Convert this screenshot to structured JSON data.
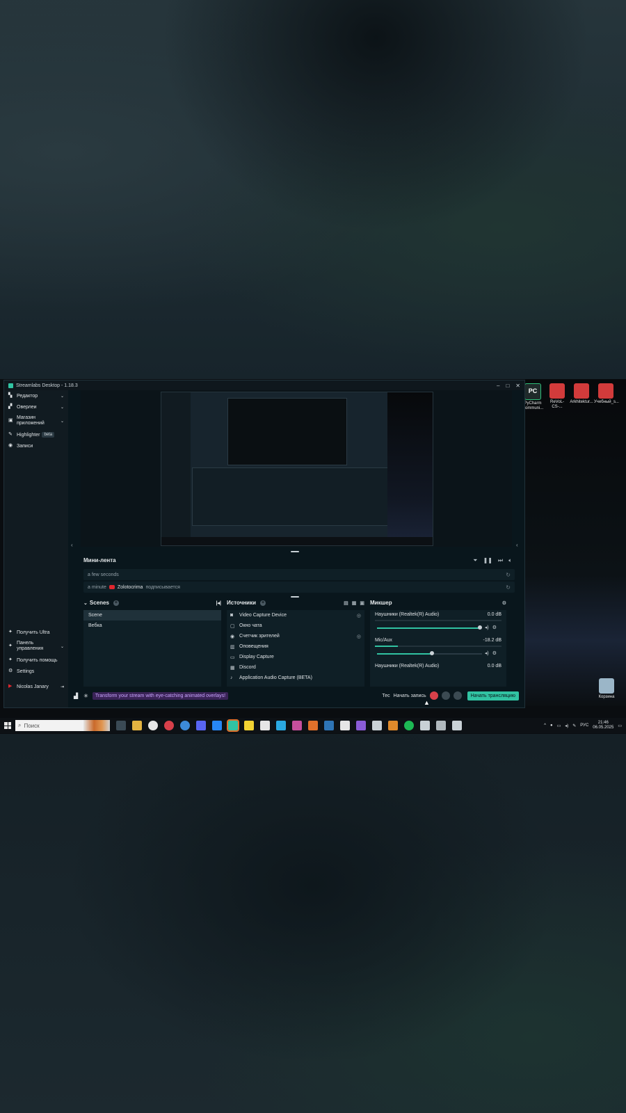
{
  "window": {
    "title": "Streamlabs Desktop - 1.18.3",
    "controls": [
      "–",
      "□",
      "✕"
    ]
  },
  "sidebar": {
    "top_items": [
      {
        "label": "Редактор",
        "icon": "editor-icon",
        "chevron": true
      },
      {
        "label": "Оверлеи",
        "icon": "overlays-icon",
        "chevron": true
      },
      {
        "label": "Магазин приложений",
        "icon": "app-store-icon",
        "chevron": true
      },
      {
        "label": "Highlighter",
        "icon": "highlighter-icon",
        "badge": "beta"
      },
      {
        "label": "Записи",
        "icon": "recordings-icon"
      }
    ],
    "bottom_items": [
      {
        "label": "Получить Ultra",
        "icon": "ultra-icon"
      },
      {
        "label": "Панель управления",
        "icon": "dashboard-icon",
        "chevron": true
      },
      {
        "label": "Получить помощь",
        "icon": "help-icon"
      },
      {
        "label": "Settings",
        "icon": "settings-icon"
      }
    ],
    "user": "Nicolas Janary"
  },
  "mini_feed": {
    "title": "Мини-лента",
    "rows": [
      {
        "time": "a few seconds",
        "user": "",
        "action": ""
      },
      {
        "time": "a minute",
        "user": "Zolotocrima",
        "action": "подписывается"
      }
    ]
  },
  "scenes": {
    "title": "Scenes",
    "items": [
      "Scene",
      "Вебка"
    ],
    "active": 0
  },
  "sources": {
    "title": "Источники",
    "items": [
      {
        "label": "Video Capture Device",
        "icon": "camera-icon",
        "eye": true
      },
      {
        "label": "Окно чата",
        "icon": "chat-icon",
        "eye": false
      },
      {
        "label": "Счетчик зрителей",
        "icon": "eye-icon",
        "eye": true
      },
      {
        "label": "Оповещения",
        "icon": "alert-icon",
        "eye": false
      },
      {
        "label": "Display Capture",
        "icon": "monitor-icon",
        "eye": false
      },
      {
        "label": "Discord",
        "icon": "discord-icon",
        "eye": false
      },
      {
        "label": "Application Audio Capture (BETA)",
        "icon": "audio-icon",
        "eye": false
      }
    ]
  },
  "mixer": {
    "title": "Микшер",
    "channels": [
      {
        "label": "Наушники (Realtek(R) Audio)",
        "db": "0.0 dB",
        "volume": 0.98,
        "meter": 0.0
      },
      {
        "label": "Mic/Aux",
        "db": "-18.2 dB",
        "volume": 0.52,
        "meter": 0.18
      },
      {
        "label": "Наушники (Realtek(R) Audio)",
        "db": "0.0 dB"
      }
    ]
  },
  "footer": {
    "promo": "Transform your stream with eye-catching animated overlays!",
    "test_label": "Тес",
    "record_label": "Начать запись",
    "go_live": "Начать трансляцию"
  },
  "desktop_icons": [
    {
      "label": "PyCharm Communi...",
      "icon": "pycharm-icon"
    },
    {
      "label": "ReVoL-CS-...",
      "icon": "pdf-icon"
    },
    {
      "label": "Arkhitektur...",
      "icon": "pdf-icon"
    },
    {
      "label": "Учебный_s...",
      "icon": "pdf-icon"
    },
    {
      "label": "Корзина",
      "icon": "recycle-bin-icon"
    }
  ],
  "taskbar": {
    "search_placeholder": "Поиск",
    "lang": "РУС",
    "time": "21:46",
    "date": "06.05.2025"
  },
  "colors": {
    "accent": "#31c3a2",
    "record_red": "#d8404a",
    "promo_purple": "#3a2357"
  }
}
